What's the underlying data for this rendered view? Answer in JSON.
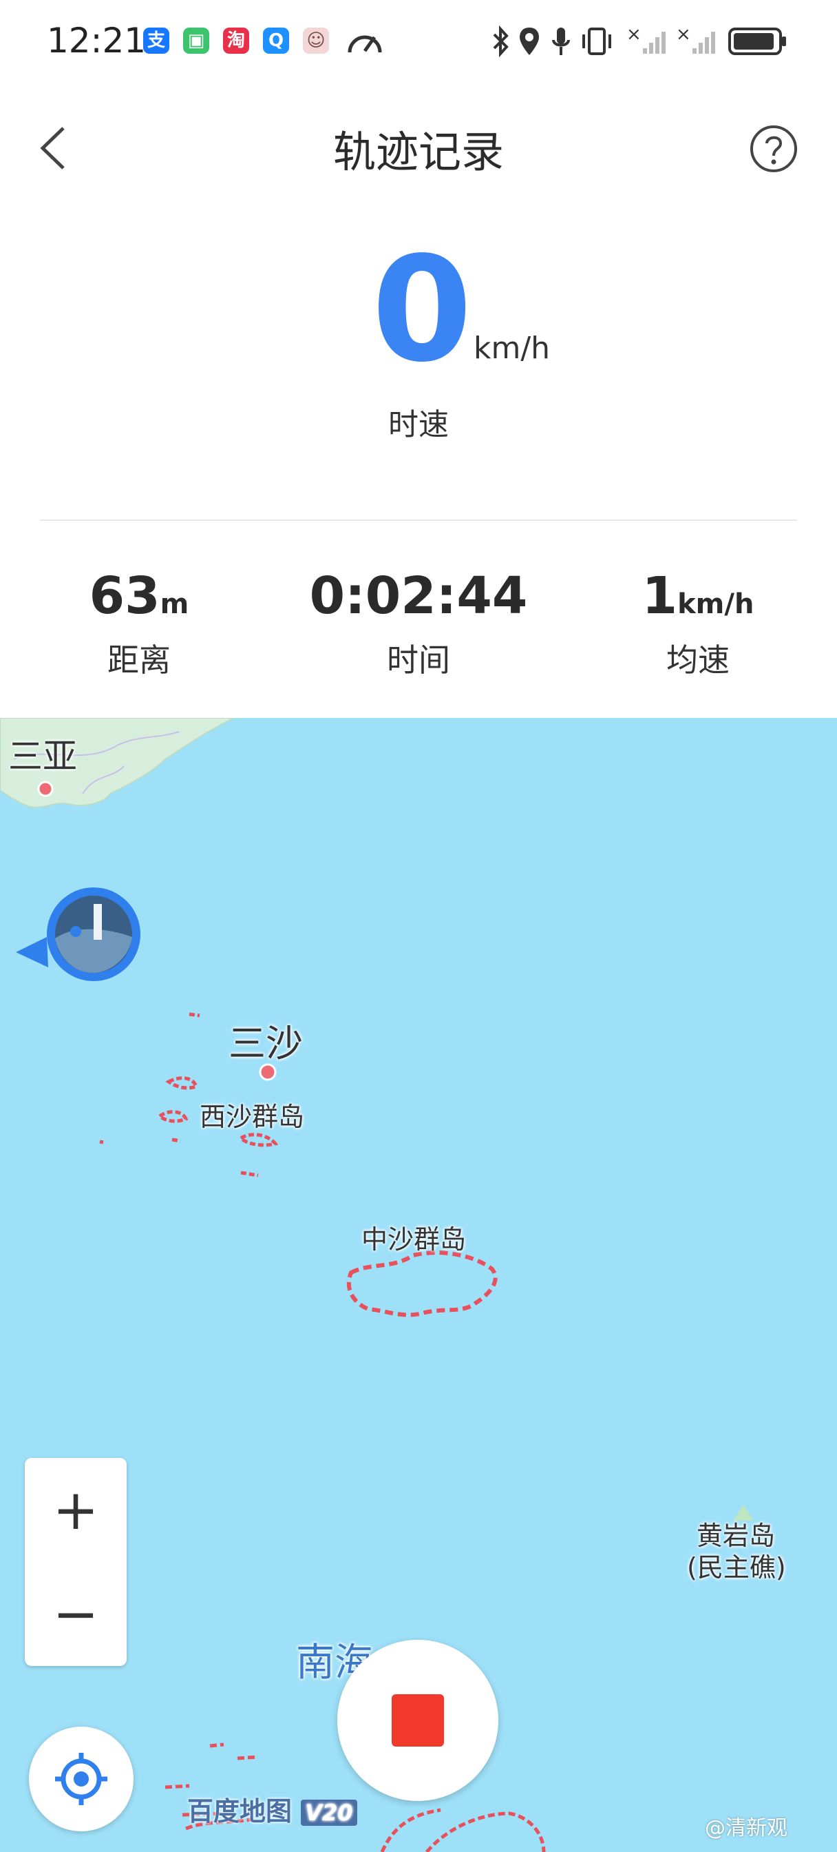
{
  "status_bar": {
    "time": "12:21",
    "app_icons": [
      {
        "name": "alipay-icon",
        "glyph": "支",
        "color": "#1677ff"
      },
      {
        "name": "sim-icon",
        "glyph": "▣",
        "color": "#3cc46c"
      },
      {
        "name": "taobao-icon",
        "glyph": "淘",
        "color": "#e8304a"
      },
      {
        "name": "search-app-icon",
        "glyph": "Q",
        "color": "#1e90ff"
      },
      {
        "name": "avatar-app-icon",
        "glyph": "☺",
        "color": "#d98c8c"
      }
    ]
  },
  "header": {
    "title": "轨迹记录"
  },
  "speed": {
    "value": "0",
    "unit": "km/h",
    "label": "时速"
  },
  "stats": [
    {
      "value": "63",
      "unit": "m",
      "label": "距离"
    },
    {
      "value": "0:02:44",
      "unit": "",
      "label": "时间"
    },
    {
      "value": "1",
      "unit": "km/h",
      "label": "均速"
    }
  ],
  "map": {
    "labels": {
      "sanya": "三亚",
      "sansha": "三沙",
      "xisha": "西沙群岛",
      "zhongsha": "中沙群岛",
      "huangyan_line1": "黄岩岛",
      "huangyan_line2": "(民主礁)",
      "nanhai": "南海"
    },
    "logo_text": "百度地图",
    "logo_version": "V20",
    "watermark": "@清新观",
    "zoom_in": "+",
    "zoom_out": "−"
  },
  "colors": {
    "accent": "#3b84f4",
    "sea": "#9ee0f8",
    "land": "#d7eedd",
    "reef": "#e8505b",
    "stop": "#f13a2c"
  }
}
